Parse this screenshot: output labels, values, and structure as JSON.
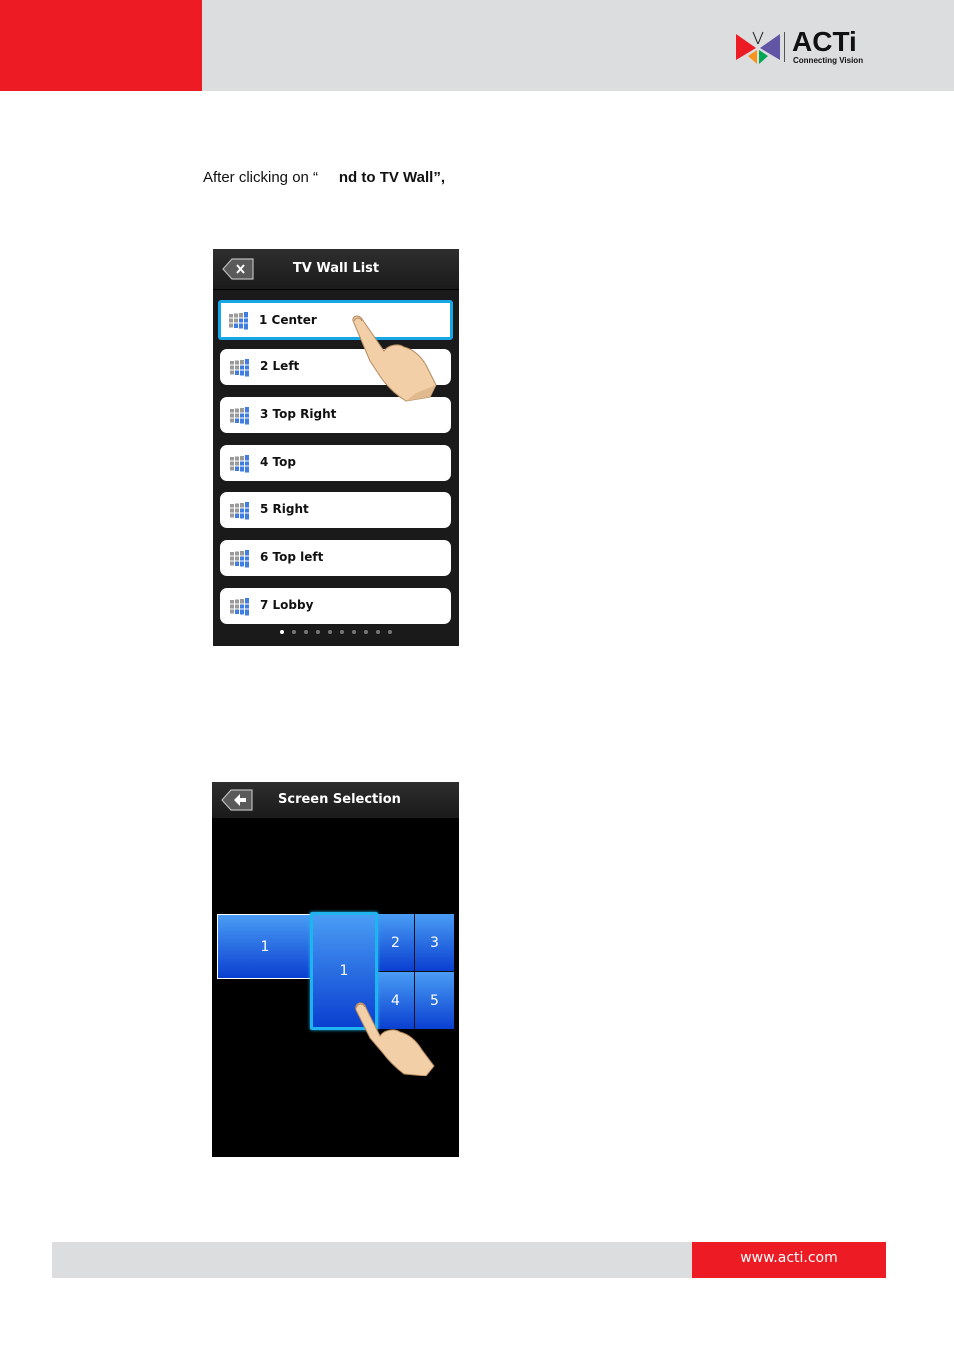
{
  "header": {
    "brand_color": "#ed1c24",
    "logo": {
      "name": "ACTi",
      "tagline": "Connecting Vision"
    }
  },
  "intro": {
    "prefix": "After clicking on “",
    "bold": "nd to TV Wall”,"
  },
  "tv_wall_list": {
    "title": "TV Wall List",
    "back_icon": "backspace-x-icon",
    "items": [
      {
        "label": "1 Center",
        "selected": true
      },
      {
        "label": "2 Left"
      },
      {
        "label": "3 Top Right"
      },
      {
        "label": "4 Top"
      },
      {
        "label": "5 Right"
      },
      {
        "label": "6 Top left"
      },
      {
        "label": "7 Lobby"
      }
    ],
    "pagination": {
      "pages": 10,
      "current": 1
    },
    "selected_color": "#17a7e6"
  },
  "screen_selection": {
    "title": "Screen Selection",
    "back_icon": "back-arrow-icon",
    "tiles": [
      {
        "label": "1",
        "role": "left-wide"
      },
      {
        "label": "1",
        "role": "selected-tall"
      },
      {
        "label": "2"
      },
      {
        "label": "3"
      },
      {
        "label": "4"
      },
      {
        "label": "5"
      }
    ]
  },
  "footer": {
    "url": "www.acti.com"
  }
}
